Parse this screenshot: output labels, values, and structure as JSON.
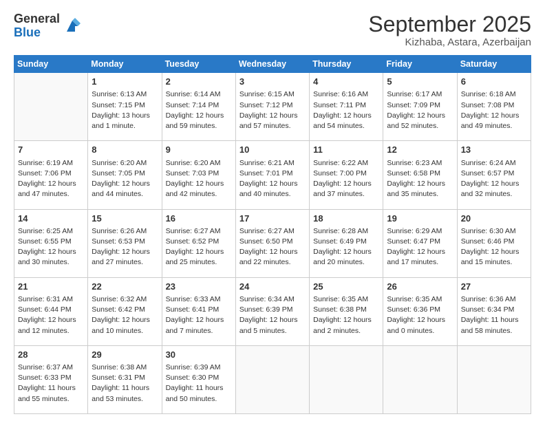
{
  "logo": {
    "general": "General",
    "blue": "Blue"
  },
  "header": {
    "month": "September 2025",
    "location": "Kizhaba, Astara, Azerbaijan"
  },
  "weekdays": [
    "Sunday",
    "Monday",
    "Tuesday",
    "Wednesday",
    "Thursday",
    "Friday",
    "Saturday"
  ],
  "weeks": [
    [
      {
        "day": "",
        "info": ""
      },
      {
        "day": "1",
        "info": "Sunrise: 6:13 AM\nSunset: 7:15 PM\nDaylight: 13 hours\nand 1 minute."
      },
      {
        "day": "2",
        "info": "Sunrise: 6:14 AM\nSunset: 7:14 PM\nDaylight: 12 hours\nand 59 minutes."
      },
      {
        "day": "3",
        "info": "Sunrise: 6:15 AM\nSunset: 7:12 PM\nDaylight: 12 hours\nand 57 minutes."
      },
      {
        "day": "4",
        "info": "Sunrise: 6:16 AM\nSunset: 7:11 PM\nDaylight: 12 hours\nand 54 minutes."
      },
      {
        "day": "5",
        "info": "Sunrise: 6:17 AM\nSunset: 7:09 PM\nDaylight: 12 hours\nand 52 minutes."
      },
      {
        "day": "6",
        "info": "Sunrise: 6:18 AM\nSunset: 7:08 PM\nDaylight: 12 hours\nand 49 minutes."
      }
    ],
    [
      {
        "day": "7",
        "info": "Sunrise: 6:19 AM\nSunset: 7:06 PM\nDaylight: 12 hours\nand 47 minutes."
      },
      {
        "day": "8",
        "info": "Sunrise: 6:20 AM\nSunset: 7:05 PM\nDaylight: 12 hours\nand 44 minutes."
      },
      {
        "day": "9",
        "info": "Sunrise: 6:20 AM\nSunset: 7:03 PM\nDaylight: 12 hours\nand 42 minutes."
      },
      {
        "day": "10",
        "info": "Sunrise: 6:21 AM\nSunset: 7:01 PM\nDaylight: 12 hours\nand 40 minutes."
      },
      {
        "day": "11",
        "info": "Sunrise: 6:22 AM\nSunset: 7:00 PM\nDaylight: 12 hours\nand 37 minutes."
      },
      {
        "day": "12",
        "info": "Sunrise: 6:23 AM\nSunset: 6:58 PM\nDaylight: 12 hours\nand 35 minutes."
      },
      {
        "day": "13",
        "info": "Sunrise: 6:24 AM\nSunset: 6:57 PM\nDaylight: 12 hours\nand 32 minutes."
      }
    ],
    [
      {
        "day": "14",
        "info": "Sunrise: 6:25 AM\nSunset: 6:55 PM\nDaylight: 12 hours\nand 30 minutes."
      },
      {
        "day": "15",
        "info": "Sunrise: 6:26 AM\nSunset: 6:53 PM\nDaylight: 12 hours\nand 27 minutes."
      },
      {
        "day": "16",
        "info": "Sunrise: 6:27 AM\nSunset: 6:52 PM\nDaylight: 12 hours\nand 25 minutes."
      },
      {
        "day": "17",
        "info": "Sunrise: 6:27 AM\nSunset: 6:50 PM\nDaylight: 12 hours\nand 22 minutes."
      },
      {
        "day": "18",
        "info": "Sunrise: 6:28 AM\nSunset: 6:49 PM\nDaylight: 12 hours\nand 20 minutes."
      },
      {
        "day": "19",
        "info": "Sunrise: 6:29 AM\nSunset: 6:47 PM\nDaylight: 12 hours\nand 17 minutes."
      },
      {
        "day": "20",
        "info": "Sunrise: 6:30 AM\nSunset: 6:46 PM\nDaylight: 12 hours\nand 15 minutes."
      }
    ],
    [
      {
        "day": "21",
        "info": "Sunrise: 6:31 AM\nSunset: 6:44 PM\nDaylight: 12 hours\nand 12 minutes."
      },
      {
        "day": "22",
        "info": "Sunrise: 6:32 AM\nSunset: 6:42 PM\nDaylight: 12 hours\nand 10 minutes."
      },
      {
        "day": "23",
        "info": "Sunrise: 6:33 AM\nSunset: 6:41 PM\nDaylight: 12 hours\nand 7 minutes."
      },
      {
        "day": "24",
        "info": "Sunrise: 6:34 AM\nSunset: 6:39 PM\nDaylight: 12 hours\nand 5 minutes."
      },
      {
        "day": "25",
        "info": "Sunrise: 6:35 AM\nSunset: 6:38 PM\nDaylight: 12 hours\nand 2 minutes."
      },
      {
        "day": "26",
        "info": "Sunrise: 6:35 AM\nSunset: 6:36 PM\nDaylight: 12 hours\nand 0 minutes."
      },
      {
        "day": "27",
        "info": "Sunrise: 6:36 AM\nSunset: 6:34 PM\nDaylight: 11 hours\nand 58 minutes."
      }
    ],
    [
      {
        "day": "28",
        "info": "Sunrise: 6:37 AM\nSunset: 6:33 PM\nDaylight: 11 hours\nand 55 minutes."
      },
      {
        "day": "29",
        "info": "Sunrise: 6:38 AM\nSunset: 6:31 PM\nDaylight: 11 hours\nand 53 minutes."
      },
      {
        "day": "30",
        "info": "Sunrise: 6:39 AM\nSunset: 6:30 PM\nDaylight: 11 hours\nand 50 minutes."
      },
      {
        "day": "",
        "info": ""
      },
      {
        "day": "",
        "info": ""
      },
      {
        "day": "",
        "info": ""
      },
      {
        "day": "",
        "info": ""
      }
    ]
  ]
}
